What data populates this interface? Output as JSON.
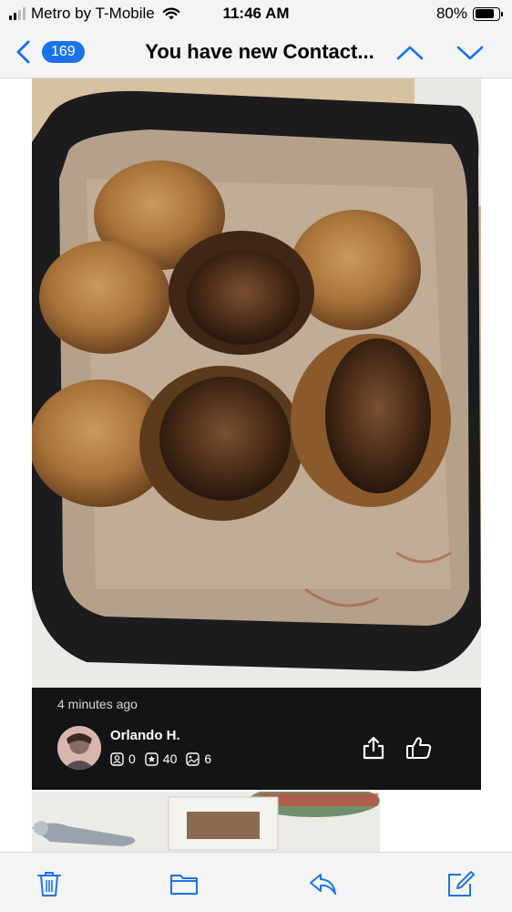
{
  "status_bar": {
    "carrier": "Metro by T-Mobile",
    "time": "11:46 AM",
    "battery": "80%"
  },
  "nav": {
    "unread_count": "169",
    "title": "You have new Contact..."
  },
  "post": {
    "time_ago": "4 minutes ago",
    "user_name": "Orlando H.",
    "friends_count": "0",
    "reviews_count": "40",
    "photos_count": "6"
  },
  "colors": {
    "accent": "#1a73e8",
    "card_footer": "#141414"
  },
  "icons": {
    "back": "chevron-left-icon",
    "previous": "chevron-up-icon",
    "next": "chevron-down-icon",
    "friends": "friends-icon",
    "reviews": "star-icon",
    "photos": "photo-icon",
    "share": "share-icon",
    "like": "thumbs-up-icon",
    "trash": "trash-icon",
    "move": "folder-icon",
    "reply": "reply-icon",
    "compose": "compose-icon"
  }
}
